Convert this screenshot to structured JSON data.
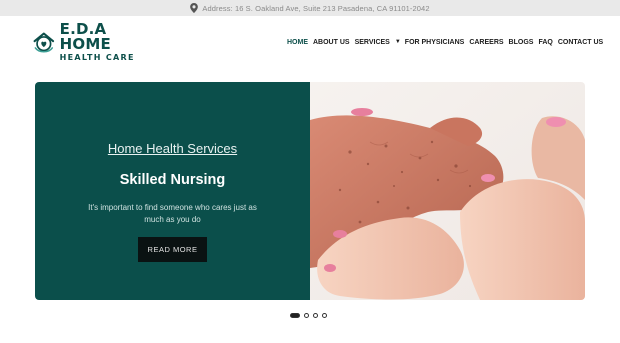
{
  "topbar": {
    "address": "Address: 16 S. Oakland Ave, Suite 213 Pasadena, CA 91101-2042",
    "icon": "location-pin-icon"
  },
  "logo": {
    "line1": "E.D.A HOME",
    "line2": "HEALTH CARE"
  },
  "nav": {
    "items": [
      "HOME",
      "ABOUT US",
      "SERVICES",
      "FOR PHYSICIANS",
      "CAREERS",
      "BLOGS",
      "FAQ",
      "CONTACT US"
    ],
    "active": "HOME"
  },
  "hero": {
    "eyebrow": "Home Health Services",
    "title": "Skilled Nursing",
    "description": "It's important to find someone who cares just as much as you do",
    "button": "READ MORE"
  },
  "carousel": {
    "total": 4,
    "active_index": 0
  },
  "colors": {
    "brand": "#0b4f4b",
    "button": "#0a1212",
    "topbar": "#e9e9e9"
  }
}
